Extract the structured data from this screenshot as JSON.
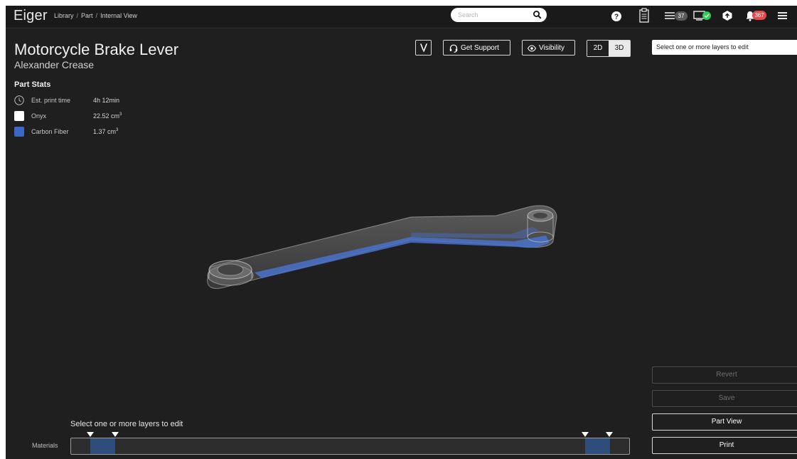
{
  "app": {
    "logo": "Eiger"
  },
  "breadcrumb": [
    "Library",
    "Part",
    "Internal View"
  ],
  "breadcrumb_sep": "/",
  "search": {
    "placeholder": "Search",
    "value": ""
  },
  "topbar": {
    "icons": [
      "help-icon",
      "clipboard-icon",
      "queue-icon",
      "printer-status-icon",
      "upload-icon",
      "notification-icon",
      "menu-icon"
    ],
    "queue_count": "37",
    "notification_count": "367",
    "status_ok_color": "#2ecc52",
    "notification_color": "#e24a4a"
  },
  "part": {
    "title": "Motorcycle Brake Lever",
    "author": "Alexander Crease"
  },
  "stats": {
    "heading": "Part Stats",
    "items": [
      {
        "icon": "clock-icon",
        "label": "Est. print time",
        "value": "4h 12min",
        "unit": ""
      },
      {
        "icon": "onyx-swatch-icon",
        "label": "Onyx",
        "value": "22.52 cm",
        "unit": "3"
      },
      {
        "icon": "carbon-fiber-swatch-icon",
        "label": "Carbon Fiber",
        "value": "1.37 cm",
        "unit": "3"
      }
    ],
    "onyx_color": "#ffffff",
    "carbon_fiber_color": "#3d67c4"
  },
  "toolbar": {
    "version_label": "",
    "support_label": "Get Support",
    "visibility_label": "Visibility",
    "mode_2d": "2D",
    "mode_3d": "3D",
    "active_mode": "2D"
  },
  "right_panel": {
    "layer_select_placeholder": "Select one or more layers to edit",
    "revert_label": "Revert",
    "save_label": "Save",
    "part_view_label": "Part View",
    "print_label": "Print"
  },
  "layer_bar": {
    "hint": "Select one or more layers to edit",
    "materials_label": "Materials",
    "range_fill_color": "#2e4d7a"
  }
}
